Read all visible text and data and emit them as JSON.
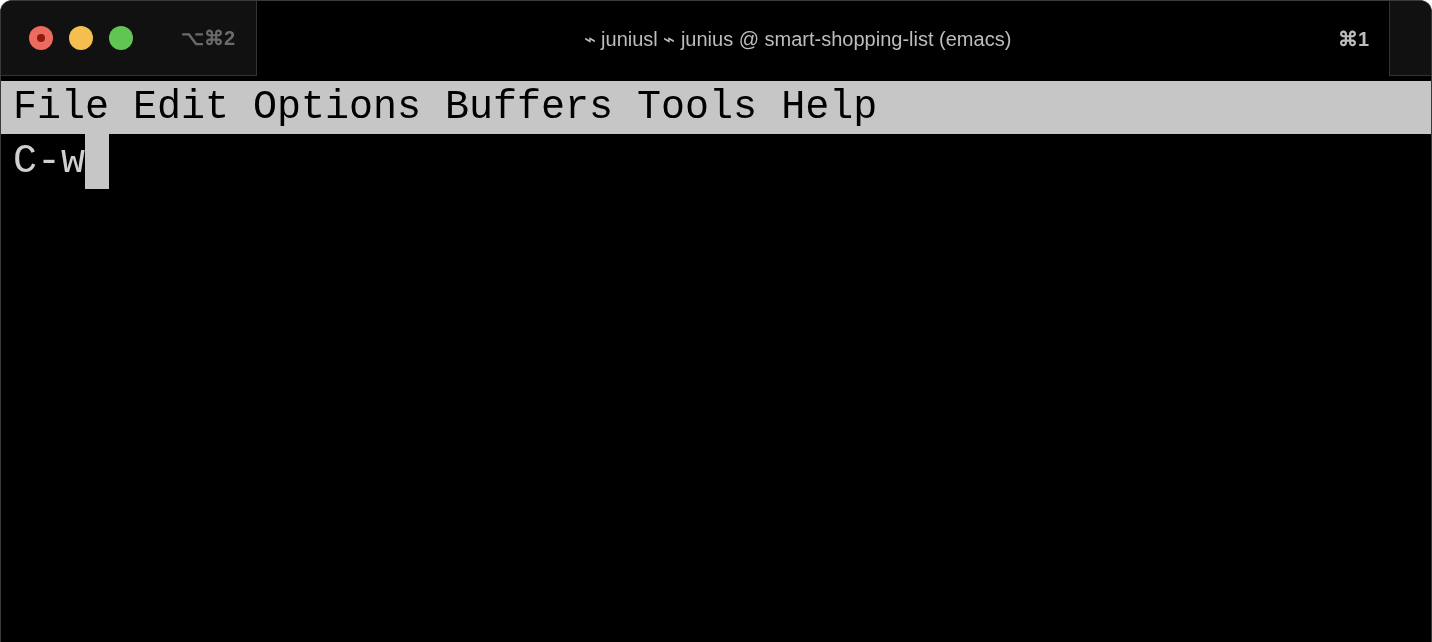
{
  "tabs": [
    {
      "label": "⌥⌘2",
      "selected": false
    },
    {
      "title": "⌁ juniusl ⌁ junius @ smart-shopping-list (emacs)",
      "label": "⌘1",
      "selected": true
    }
  ],
  "menu_bar": [
    "File",
    "Edit",
    "Options",
    "Buffers",
    "Tools",
    "Help"
  ],
  "buffer": {
    "text": "C-w",
    "cursor": true
  }
}
